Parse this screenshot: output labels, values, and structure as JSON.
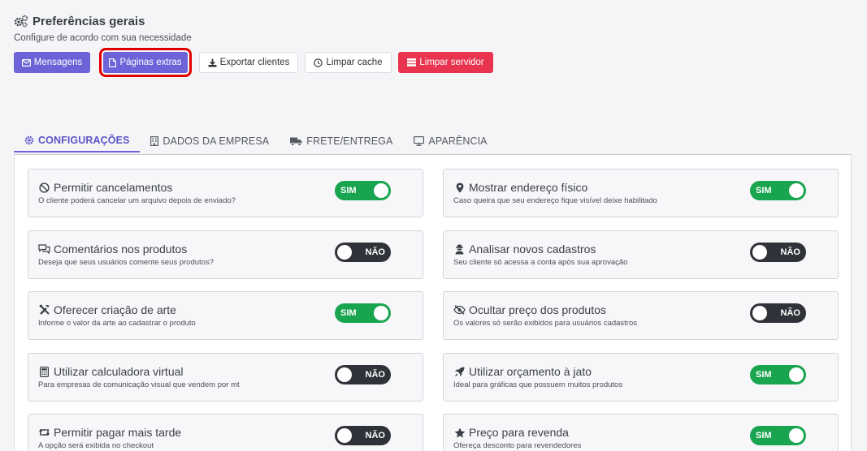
{
  "header": {
    "title": "Preferências gerais",
    "subtitle": "Configure de acordo com sua necessidade"
  },
  "actions": [
    {
      "label": "Mensagens",
      "icon": "envelope-icon",
      "style": "primary"
    },
    {
      "label": "Páginas extras",
      "icon": "file-icon",
      "style": "primary",
      "highlighted": true
    },
    {
      "label": "Exportar clientes",
      "icon": "download-icon",
      "style": "light"
    },
    {
      "label": "Limpar cache",
      "icon": "clock-icon",
      "style": "light"
    },
    {
      "label": "Limpar servidor",
      "icon": "server-icon",
      "style": "danger"
    }
  ],
  "tabs": [
    {
      "label": "CONFIGURAÇÕES",
      "icon": "gear-icon",
      "active": true
    },
    {
      "label": "DADOS DA EMPRESA",
      "icon": "building-icon",
      "active": false
    },
    {
      "label": "FRETE/ENTREGA",
      "icon": "truck-icon",
      "active": false
    },
    {
      "label": "APARÊNCIA",
      "icon": "monitor-icon",
      "active": false
    }
  ],
  "toggle_labels": {
    "on": "SIM",
    "off": "NÃO"
  },
  "settings": [
    {
      "title": "Permitir cancelamentos",
      "desc": "O cliente poderá cancelar um arquivo depois de enviado?",
      "icon": "ban-icon",
      "value": true
    },
    {
      "title": "Mostrar endereço físico",
      "desc": "Caso queira que seu endereço fique visível deixe habilitado",
      "icon": "map-marker-icon",
      "value": true
    },
    {
      "title": "Comentários nos produtos",
      "desc": "Deseja que seus usuários comente seus produtos?",
      "icon": "comments-icon",
      "value": false
    },
    {
      "title": "Analisar novos cadastros",
      "desc": "Seu cliente só acessa a conta após sua aprovação",
      "icon": "user-secret-icon",
      "value": false
    },
    {
      "title": "Oferecer criação de arte",
      "desc": "Informe o valor da arte ao cadastrar o produto",
      "icon": "tools-icon",
      "value": true
    },
    {
      "title": "Ocultar preço dos produtos",
      "desc": "Os valores só serão exibidos para usuários cadastros",
      "icon": "eye-slash-icon",
      "value": false
    },
    {
      "title": "Utilizar calculadora virtual",
      "desc": "Para empresas de comunicação visual que vendem por mt",
      "icon": "calculator-icon",
      "value": false
    },
    {
      "title": "Utilizar orçamento à jato",
      "desc": "Ideal para gráficas que possuem muitos produtos",
      "icon": "rocket-icon",
      "value": true
    },
    {
      "title": "Permitir pagar mais tarde",
      "desc": "A opção será exibida no checkout",
      "icon": "retweet-icon",
      "value": false
    },
    {
      "title": "Preço para revenda",
      "desc": "Ofereça desconto para revendedores",
      "icon": "star-icon",
      "value": true
    }
  ]
}
